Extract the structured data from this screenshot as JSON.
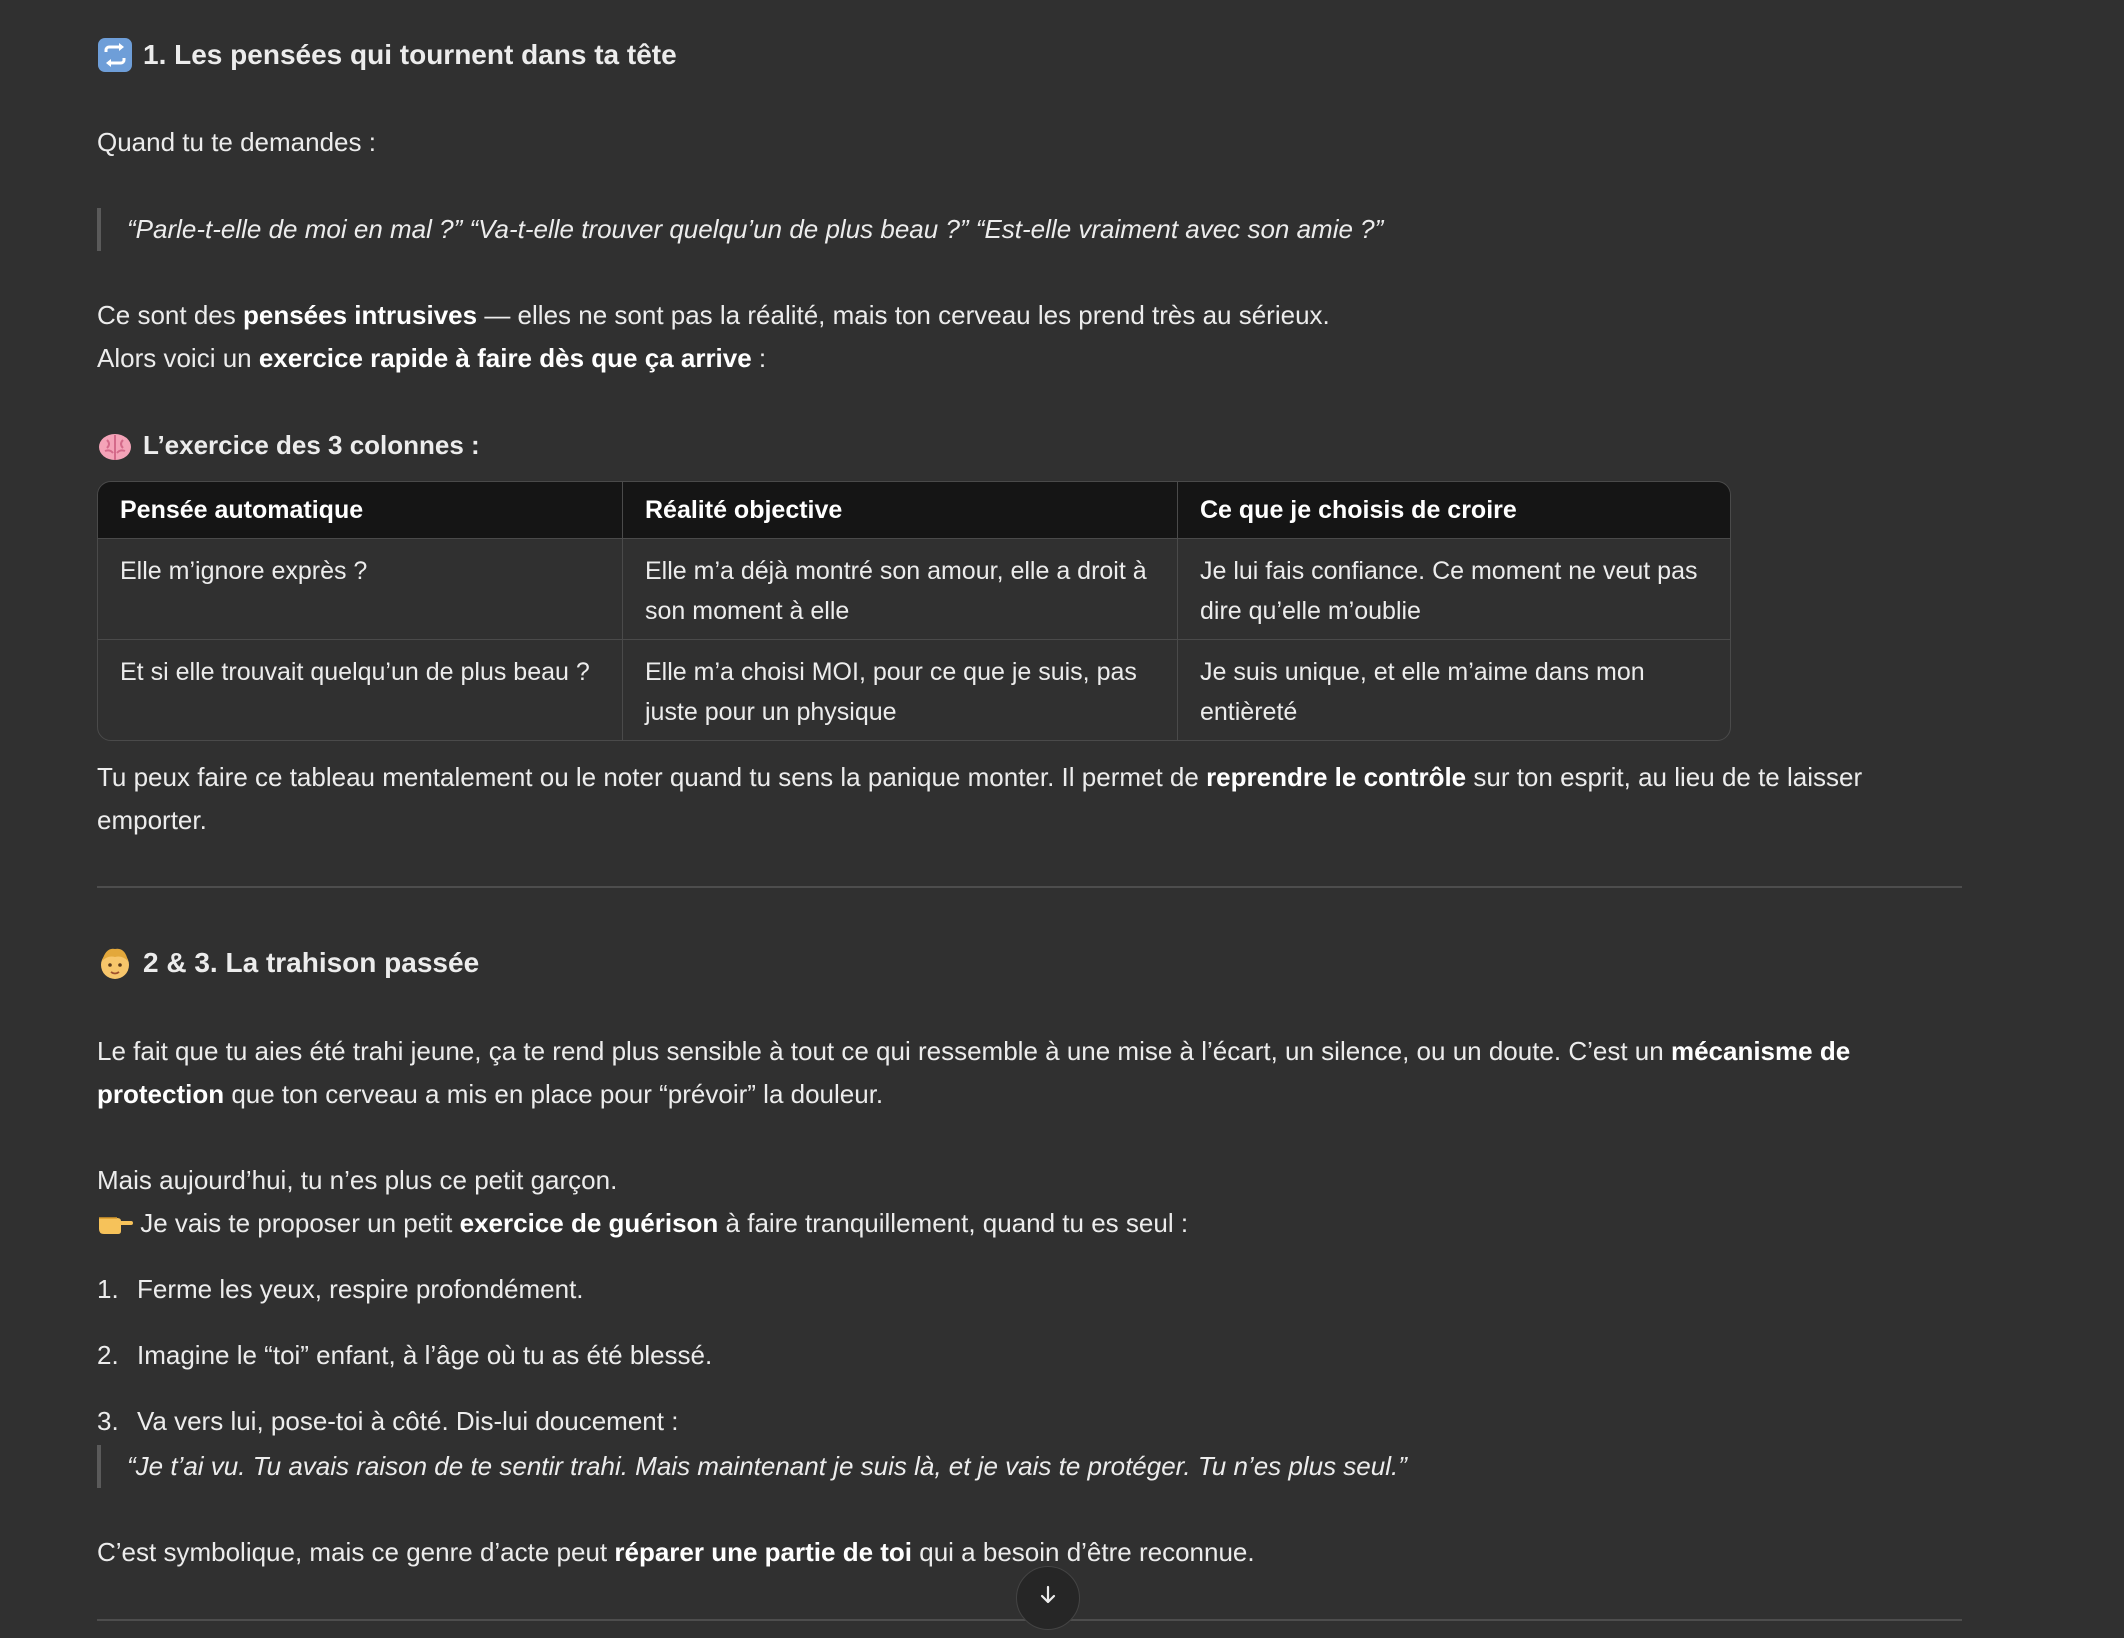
{
  "section1": {
    "title": "1. Les pensées qui tournent dans ta tête",
    "intro": "Quand tu te demandes :",
    "quote": "“Parle-t-elle de moi en mal ?” “Va-t-elle trouver quelqu’un de plus beau ?” “Est-elle vraiment avec son amie ?”",
    "para1_a": "Ce sont des ",
    "para1_b": "pensées intrusives",
    "para1_c": " — elles ne sont pas la réalité, mais ton cerveau les prend très au sérieux.",
    "para2_a": "Alors voici un ",
    "para2_b": "exercice rapide à faire dès que ça arrive",
    "para2_c": " :",
    "subtitle": "L’exercice des 3 colonnes :",
    "table": {
      "headers": [
        "Pensée automatique",
        "Réalité objective",
        "Ce que je choisis de croire"
      ],
      "rows": [
        [
          "Elle m’ignore exprès ?",
          "Elle m’a déjà montré son amour, elle a droit à son moment à elle",
          "Je lui fais confiance. Ce moment ne veut pas dire qu’elle m’oublie"
        ],
        [
          "Et si elle trouvait quelqu’un de plus beau ?",
          "Elle m’a choisi MOI, pour ce que je suis, pas juste pour un physique",
          "Je suis unique, et elle m’aime dans mon entièreté"
        ]
      ]
    },
    "outro_a": "Tu peux faire ce tableau mentalement ou le noter quand tu sens la panique monter. Il permet de ",
    "outro_b": "reprendre le contrôle",
    "outro_c": " sur ton esprit, au lieu de te laisser emporter."
  },
  "section2": {
    "title": "2 & 3. La trahison passée",
    "para1_a": "Le fait que tu aies été trahi jeune, ça te rend plus sensible à tout ce qui ressemble à une mise à l’écart, un silence, ou un doute. C’est un ",
    "para1_b": "mécanisme de protection",
    "para1_c": " que ton cerveau a mis en place pour “prévoir” la douleur.",
    "para2": "Mais aujourd’hui, tu n’es plus ce petit garçon.",
    "para3_a": " Je vais te proposer un petit ",
    "para3_b": "exercice de guérison",
    "para3_c": " à faire tranquillement, quand tu es seul :",
    "steps": [
      {
        "num": "1.",
        "text": "Ferme les yeux, respire profondément."
      },
      {
        "num": "2.",
        "text": "Imagine le “toi” enfant, à l’âge où tu as été blessé."
      },
      {
        "num": "3.",
        "text": "Va vers lui, pose-toi à côté. Dis-lui doucement :"
      }
    ],
    "quote": "“Je t’ai vu. Tu avais raison de te sentir trahi. Mais maintenant je suis là, et je vais te protéger. Tu n’es plus seul.”",
    "outro_a": "C’est symbolique, mais ce genre d’acte peut ",
    "outro_b": "réparer une partie de toi",
    "outro_c": " qui a besoin d’être reconnue."
  },
  "icons": {
    "repeat": "repeat-icon",
    "brain": "brain-icon",
    "child": "child-face-icon",
    "pointing": "pointing-right-icon",
    "scroll": "arrow-down-icon"
  },
  "colors": {
    "background": "#303030",
    "text": "#ececec",
    "table_header": "#151515",
    "border": "#4a4a4a"
  }
}
